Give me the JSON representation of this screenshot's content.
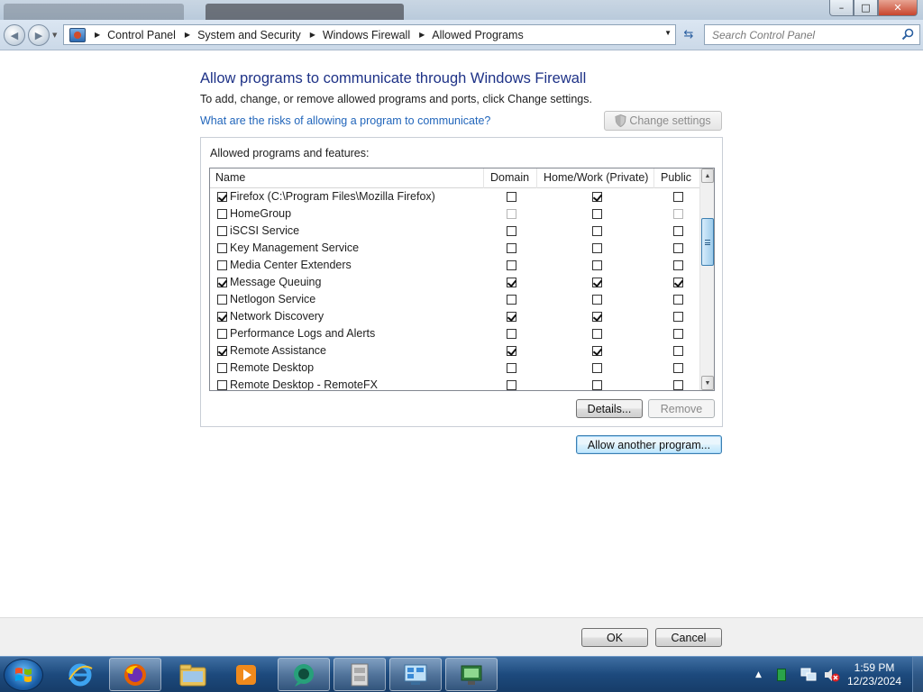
{
  "window": {
    "minimize_glyph": "–",
    "maximize_glyph": "□",
    "close_glyph": "✕"
  },
  "navigation": {
    "breadcrumb": [
      "Control Panel",
      "System and Security",
      "Windows Firewall",
      "Allowed Programs"
    ],
    "search_placeholder": "Search Control Panel",
    "icons": [
      "back-icon",
      "forward-icon",
      "control-panel-icon",
      "refresh-icon",
      "search-icon"
    ]
  },
  "page": {
    "heading": "Allow programs to communicate through Windows Firewall",
    "subtext": "To add, change, or remove allowed programs and ports, click Change settings.",
    "risks_link": "What are the risks of allowing a program to communicate?",
    "change_settings": "Change settings",
    "group_label": "Allowed programs and features:",
    "columns": {
      "name": "Name",
      "domain": "Domain",
      "private": "Home/Work (Private)",
      "public": "Public"
    },
    "programs": [
      {
        "name": "Firefox (C:\\Program Files\\Mozilla Firefox)",
        "enabled": true,
        "domain": false,
        "private": true,
        "public": false
      },
      {
        "name": "HomeGroup",
        "enabled": false,
        "domain": false,
        "private": false,
        "public": false,
        "domain_disabled": true,
        "public_disabled": true
      },
      {
        "name": "iSCSI Service",
        "enabled": false,
        "domain": false,
        "private": false,
        "public": false
      },
      {
        "name": "Key Management Service",
        "enabled": false,
        "domain": false,
        "private": false,
        "public": false
      },
      {
        "name": "Media Center Extenders",
        "enabled": false,
        "domain": false,
        "private": false,
        "public": false
      },
      {
        "name": "Message Queuing",
        "enabled": true,
        "domain": true,
        "private": true,
        "public": true
      },
      {
        "name": "Netlogon Service",
        "enabled": false,
        "domain": false,
        "private": false,
        "public": false
      },
      {
        "name": "Network Discovery",
        "enabled": true,
        "domain": true,
        "private": true,
        "public": false
      },
      {
        "name": "Performance Logs and Alerts",
        "enabled": false,
        "domain": false,
        "private": false,
        "public": false
      },
      {
        "name": "Remote Assistance",
        "enabled": true,
        "domain": true,
        "private": true,
        "public": false
      },
      {
        "name": "Remote Desktop",
        "enabled": false,
        "domain": false,
        "private": false,
        "public": false
      },
      {
        "name": "Remote Desktop - RemoteFX",
        "enabled": false,
        "domain": false,
        "private": false,
        "public": false
      }
    ],
    "details_button": "Details...",
    "remove_button": "Remove",
    "allow_another_button": "Allow another program..."
  },
  "footer": {
    "ok": "OK",
    "cancel": "Cancel"
  },
  "taskbar": {
    "apps": [
      "internet-explorer-icon",
      "firefox-icon",
      "windows-explorer-icon",
      "media-player-icon",
      "chat-app-icon",
      "file-cabinet-icon",
      "control-panel-taskbar-icon",
      "network-app-icon"
    ],
    "time": "1:59 PM",
    "date": "12/23/2024",
    "tray_up_arrow": "▲"
  }
}
